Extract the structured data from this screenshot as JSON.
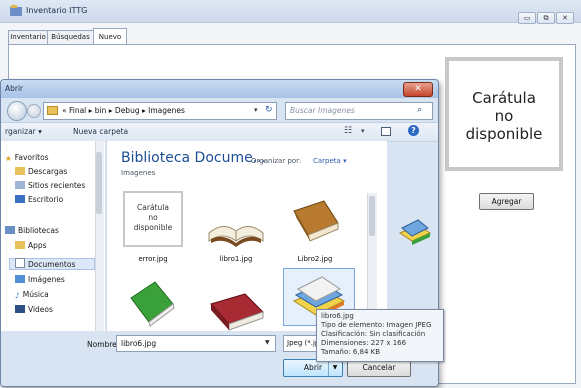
{
  "main_window": {
    "title": "Inventario ITTG",
    "tabs": [
      "Inventario",
      "Búsquedas",
      "Nuevo"
    ],
    "cover_text_lines": [
      "Carátula",
      "no",
      "disponible"
    ],
    "add_button": "Agregar",
    "window_buttons": [
      "▭",
      "⧉",
      "✕"
    ]
  },
  "dialog": {
    "title": "Abrir",
    "close_glyph": "✕",
    "breadcrumb": "« Final ▸ bin ▸ Debug ▸ Imagenes",
    "search_placeholder": "Buscar Imagenes",
    "toolbar": {
      "organize": "rganizar ▾",
      "new_folder": "Nueva carpeta"
    },
    "nav_pane": {
      "favorites_header": "Favoritos",
      "favorites": [
        "Descargas",
        "Sitios recientes",
        "Escritorio"
      ],
      "libraries_header": "Bibliotecas",
      "libraries": [
        "Apps",
        "Documentos",
        "Imágenes",
        "Música",
        "Videos"
      ],
      "selected": "Documentos"
    },
    "content": {
      "library_title": "Biblioteca Docume...",
      "library_subtitle": "Imagenes",
      "arrange_label": "Organizar por:",
      "arrange_value": "Carpeta ▾",
      "error_thumb_lines": [
        "Carátula",
        "no",
        "disponible"
      ],
      "files": [
        "error.jpg",
        "libro1.jpg",
        "Libro2.jpg"
      ],
      "selected_file": "libro6.jpg"
    },
    "tooltip": {
      "lines": [
        "libro6.jpg",
        "Tipo de elemento: Imagen JPEG",
        "Clasificación: Sin clasificación",
        "Dimensiones: 227 x 166",
        "Tamaño: 6,84 KB"
      ]
    },
    "bottom": {
      "name_label": "Nombre:",
      "name_value": "libro6.jpg",
      "filter_value": "Jpeg (*.jp",
      "open_button": "Abrir",
      "cancel_button": "Cancelar"
    }
  }
}
